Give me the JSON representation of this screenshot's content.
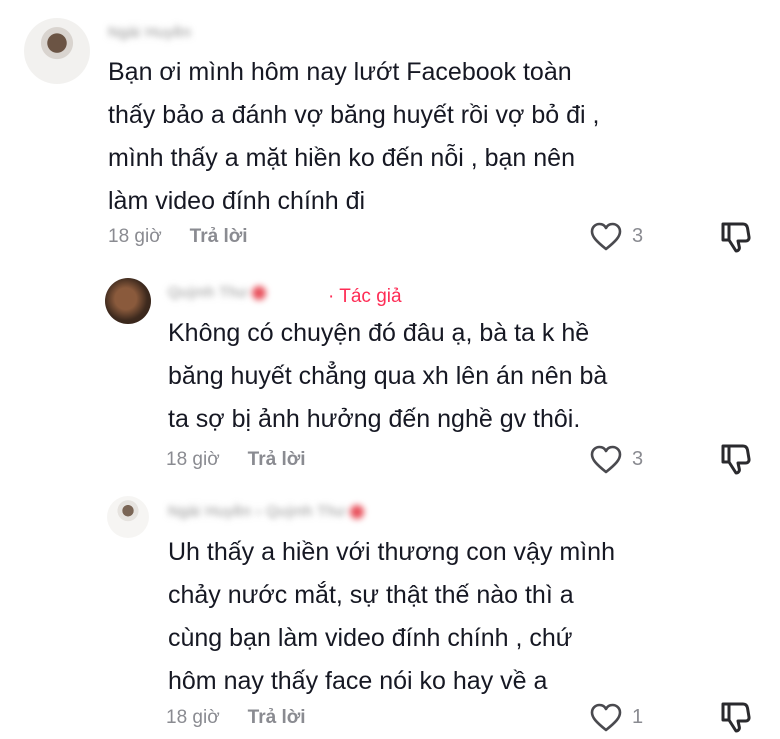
{
  "comments": [
    {
      "username": "Ngài Huyền",
      "text_lines": [
        "Bạn ơi mình hôm nay lướt Facebook toàn",
        "thấy bảo a đánh vợ băng huyết rồi vợ bỏ đi ,",
        "mình thấy a mặt hiền ko đến nỗi , bạn nên",
        "làm video đính chính đi"
      ],
      "time": "18 giờ",
      "reply_label": "Trả lời",
      "likes": "3"
    },
    {
      "username": "Quỳnh Thư",
      "author_tag": "· Tác giả",
      "text_lines": [
        "Không có chuyện đó đâu ạ, bà ta k hề",
        "băng huyết chẳng qua xh lên án nên bà",
        "ta sợ bị ảnh hưởng đến nghề gv thôi."
      ],
      "time": "18 giờ",
      "reply_label": "Trả lời",
      "likes": "3"
    },
    {
      "username": "Ngài Huyền › Quỳnh Thư",
      "text_lines": [
        "Uh thấy a hiền với thương con vậy mình",
        "chảy nước mắt, sự thật thế nào thì a",
        "cùng bạn làm video đính chính , chứ",
        "hôm nay thấy face nói ko hay về a"
      ],
      "time": "18 giờ",
      "reply_label": "Trả lời",
      "likes": "1"
    }
  ],
  "icons": {
    "like": "heart-outline-icon",
    "dislike": "thumbs-down-icon"
  },
  "colors": {
    "author_tag": "#fe2c55",
    "meta": "#8a8b91",
    "text": "#161823"
  }
}
